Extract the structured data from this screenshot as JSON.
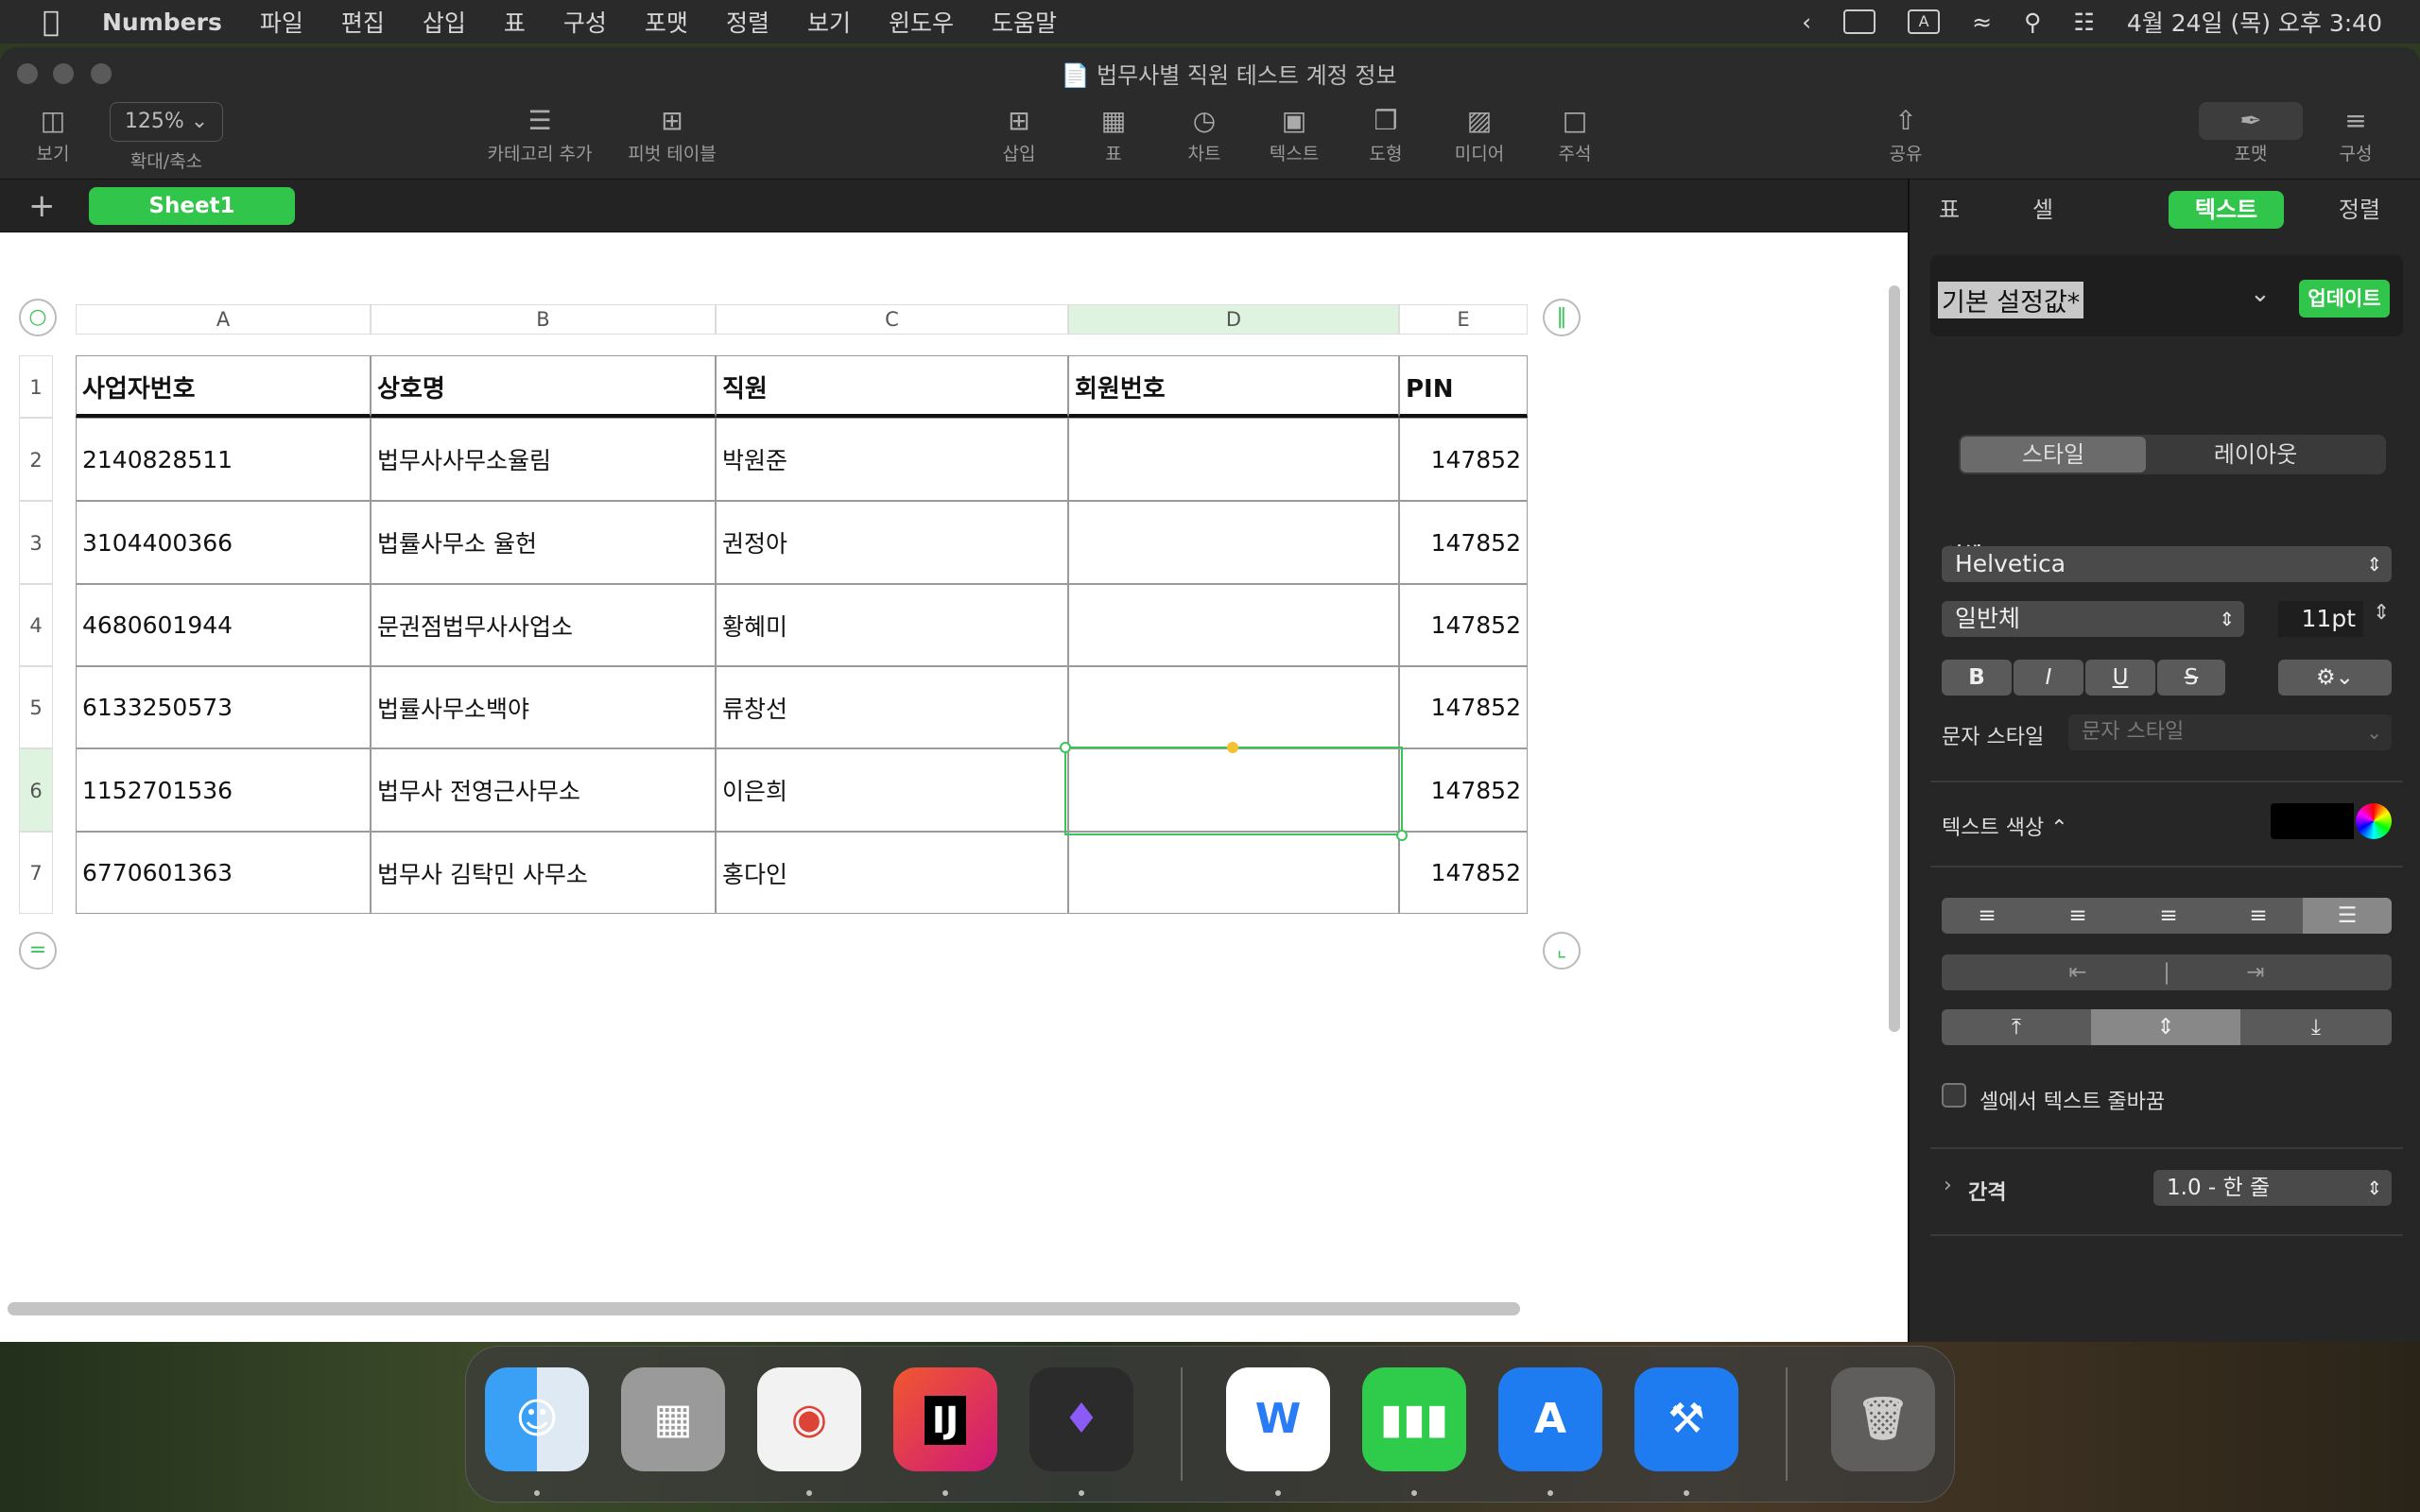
{
  "menubar": {
    "app_name": "Numbers",
    "menus": [
      "파일",
      "편집",
      "삽입",
      "표",
      "구성",
      "포맷",
      "정렬",
      "보기",
      "윈도우",
      "도움말"
    ],
    "input_indicator": "A",
    "clock": "4월 24일 (목) 오후 3:40"
  },
  "window": {
    "title": "법무사별 직원 테스트 계정 정보",
    "toolbar": {
      "view": "보기",
      "zoom_value": "125%",
      "zoom": "확대/축소",
      "add_category": "카테고리 추가",
      "pivot": "피벗 테이블",
      "insert": "삽입",
      "table": "표",
      "chart": "차트",
      "text": "텍스트",
      "shape": "도형",
      "media": "미디어",
      "comment": "주석",
      "share": "공유",
      "format": "포맷",
      "organize": "구성"
    }
  },
  "sheets": {
    "add": "+",
    "active": "Sheet1"
  },
  "table": {
    "columns": [
      "A",
      "B",
      "C",
      "D",
      "E"
    ],
    "row_numbers": [
      "1",
      "2",
      "3",
      "4",
      "5",
      "6",
      "7"
    ],
    "headers": [
      "사업자번호",
      "상호명",
      "직원",
      "회원번호",
      "PIN"
    ],
    "rows": [
      [
        "2140828511",
        "법무사사무소율림",
        "박원준",
        "",
        "147852"
      ],
      [
        "3104400366",
        "법률사무소 율헌",
        "권정아",
        "",
        "147852"
      ],
      [
        "4680601944",
        "문권점법무사사업소",
        "황혜미",
        "",
        "147852"
      ],
      [
        "6133250573",
        "법률사무소백야",
        "류창선",
        "",
        "147852"
      ],
      [
        "1152701536",
        "법무사 전영근사무소",
        "이은희",
        "",
        "147852"
      ],
      [
        "6770601363",
        "법무사 김탁민 사무소",
        "홍다인",
        "",
        "147852"
      ]
    ],
    "selected_cell": "D6"
  },
  "inspector": {
    "tabs": [
      "표",
      "셀",
      "텍스트",
      "정렬"
    ],
    "active_tab": "텍스트",
    "paragraph_style": "기본 설정값*",
    "update": "업데이트",
    "segments": [
      "스타일",
      "레이아웃"
    ],
    "font_label": "서체",
    "font_name": "Helvetica",
    "font_weight": "일반체",
    "font_size": "11pt",
    "bold": "B",
    "italic": "I",
    "underline": "U",
    "strike": "S",
    "char_style_label": "문자 스타일",
    "char_style_placeholder": "문자 스타일",
    "text_color_label": "텍스트 색상 ⌃",
    "text_color": "#000000",
    "wrap_label": "셀에서 텍스트 줄바꿈",
    "spacing_label": "간격",
    "spacing_value": "1.0 - 한 줄"
  },
  "dock": {
    "apps": [
      {
        "name": "Finder",
        "color": "#2f8cf0"
      },
      {
        "name": "Launchpad",
        "color": "#8a8a8a"
      },
      {
        "name": "Chrome",
        "color": "#f2f2f2"
      },
      {
        "name": "IntelliJ IDEA",
        "color": "#e8432e"
      },
      {
        "name": "Obsidian",
        "color": "#2b2b2b"
      },
      {
        "name": "Whale",
        "color": "#ffffff"
      },
      {
        "name": "Numbers",
        "color": "#2ecc4a"
      },
      {
        "name": "App Store Dev",
        "color": "#1e7cf0"
      },
      {
        "name": "Xcode",
        "color": "#1e7cf0"
      },
      {
        "name": "Trash",
        "color": "#6b6b6b"
      }
    ]
  }
}
